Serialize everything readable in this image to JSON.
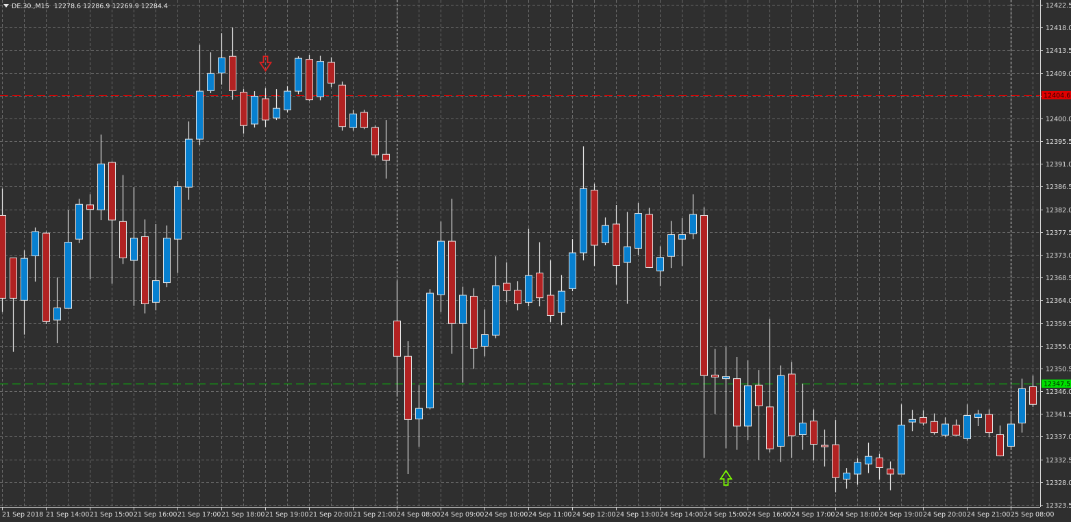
{
  "header": {
    "symbol": "DE.30.,M15",
    "open": "12278.6",
    "high": "12286.9",
    "low": "12269.9",
    "close": "12284.4"
  },
  "colors": {
    "background": "#2f2f2f",
    "grid": "#6a6a6a",
    "bull": "#0780d0",
    "bear": "#b22222",
    "candle_outline": "#e6e6e6",
    "axis_text": "#e0e0e0",
    "bid_line": "#e00000",
    "level_line": "#00dd00"
  },
  "chart_data": {
    "type": "candlestick",
    "title": "DE.30.,M15",
    "ylim": [
      12323.5,
      12422.5
    ],
    "grid": true,
    "y_ticks": [
      "12422.5",
      "12418.0",
      "12413.5",
      "12409.0",
      "12404.5",
      "12400.0",
      "12395.5",
      "12391.0",
      "12386.5",
      "12382.0",
      "12377.5",
      "12373.0",
      "12368.5",
      "12364.0",
      "12359.5",
      "12355.0",
      "12350.5",
      "12346.0",
      "12341.5",
      "12337.0",
      "12332.5",
      "12328.0",
      "12323.5"
    ],
    "x_ticks": [
      "21 Sep 2018",
      "21 Sep 14:00",
      "21 Sep 15:00",
      "21 Sep 16:00",
      "21 Sep 17:00",
      "21 Sep 18:00",
      "21 Sep 19:00",
      "21 Sep 20:00",
      "21 Sep 21:00",
      "24 Sep 08:00",
      "24 Sep 09:00",
      "24 Sep 10:00",
      "24 Sep 11:00",
      "24 Sep 12:00",
      "24 Sep 13:00",
      "24 Sep 14:00",
      "24 Sep 15:00",
      "24 Sep 16:00",
      "24 Sep 17:00",
      "24 Sep 18:00",
      "24 Sep 19:00",
      "24 Sep 20:00",
      "24 Sep 21:00",
      "25 Sep 08:00"
    ],
    "candle_fields": [
      "open",
      "high",
      "low",
      "close"
    ],
    "candles": [
      [
        12380.8,
        12386.1,
        12361.7,
        12364.4
      ],
      [
        12372.4,
        12372.4,
        12353.8,
        12364.4
      ],
      [
        12364.0,
        12373.9,
        12357.2,
        12372.3
      ],
      [
        12372.8,
        12378.4,
        12367.7,
        12377.6
      ],
      [
        12377.3,
        12377.6,
        12359.3,
        12359.8
      ],
      [
        12360.1,
        12368.5,
        12355.5,
        12362.5
      ],
      [
        12362.4,
        12381.9,
        12362.4,
        12375.5
      ],
      [
        12376.1,
        12384.1,
        12375.3,
        12383.0
      ],
      [
        12382.9,
        12385.0,
        12368.2,
        12382.0
      ],
      [
        12381.9,
        12396.8,
        12379.9,
        12391.0
      ],
      [
        12391.3,
        12391.5,
        12367.3,
        12379.9
      ],
      [
        12379.6,
        12388.8,
        12371.2,
        12372.4
      ],
      [
        12371.9,
        12386.4,
        12362.9,
        12376.3
      ],
      [
        12376.6,
        12380.0,
        12361.4,
        12363.3
      ],
      [
        12363.6,
        12379.1,
        12362.0,
        12367.9
      ],
      [
        12367.5,
        12378.8,
        12366.6,
        12376.3
      ],
      [
        12376.1,
        12387.6,
        12369.4,
        12386.5
      ],
      [
        12386.4,
        12399.4,
        12383.9,
        12395.9
      ],
      [
        12395.9,
        12414.6,
        12394.7,
        12405.4
      ],
      [
        12405.5,
        12413.1,
        12405.0,
        12408.9
      ],
      [
        12409.0,
        12416.9,
        12406.7,
        12412.0
      ],
      [
        12412.3,
        12418.0,
        12403.7,
        12405.5
      ],
      [
        12405.2,
        12405.8,
        12397.0,
        12398.6
      ],
      [
        12398.9,
        12405.4,
        12398.2,
        12404.4
      ],
      [
        12403.9,
        12406.0,
        12398.3,
        12399.7
      ],
      [
        12400.1,
        12405.8,
        12399.7,
        12402.0
      ],
      [
        12401.7,
        12406.4,
        12401.2,
        12405.4
      ],
      [
        12405.4,
        12412.3,
        12404.8,
        12411.9
      ],
      [
        12411.7,
        12412.6,
        12403.5,
        12403.7
      ],
      [
        12404.3,
        12412.4,
        12403.6,
        12411.3
      ],
      [
        12411.1,
        12412.1,
        12406.2,
        12407.0
      ],
      [
        12406.6,
        12407.3,
        12397.6,
        12398.4
      ],
      [
        12398.2,
        12401.7,
        12397.6,
        12400.9
      ],
      [
        12401.2,
        12401.7,
        12397.9,
        12398.2
      ],
      [
        12398.2,
        12398.6,
        12392.2,
        12392.8
      ],
      [
        12392.9,
        12399.7,
        12388.1,
        12391.7
      ],
      [
        12359.9,
        12367.8,
        12345.0,
        12352.9
      ],
      [
        12352.9,
        12355.9,
        12329.6,
        12340.4
      ],
      [
        12340.5,
        12347.2,
        12335.0,
        12342.6
      ],
      [
        12342.7,
        12366.2,
        12342.4,
        12365.4
      ],
      [
        12365.1,
        12379.6,
        12361.7,
        12375.7
      ],
      [
        12375.7,
        12384.1,
        12353.4,
        12359.4
      ],
      [
        12359.4,
        12366.7,
        12347.7,
        12365.0
      ],
      [
        12364.8,
        12366.4,
        12350.4,
        12354.5
      ],
      [
        12354.9,
        12362.2,
        12352.9,
        12357.2
      ],
      [
        12357.1,
        12372.7,
        12356.5,
        12366.9
      ],
      [
        12367.4,
        12371.5,
        12363.6,
        12365.9
      ],
      [
        12366.0,
        12367.8,
        12362.0,
        12363.3
      ],
      [
        12363.6,
        12378.2,
        12362.8,
        12368.9
      ],
      [
        12369.4,
        12375.5,
        12362.8,
        12364.5
      ],
      [
        12365.0,
        12371.9,
        12359.7,
        12361.0
      ],
      [
        12361.6,
        12369.0,
        12359.1,
        12365.8
      ],
      [
        12366.3,
        12376.1,
        12365.8,
        12373.4
      ],
      [
        12373.4,
        12394.5,
        12371.9,
        12386.1
      ],
      [
        12385.8,
        12387.1,
        12370.8,
        12374.9
      ],
      [
        12375.4,
        12380.4,
        12374.9,
        12378.8
      ],
      [
        12379.1,
        12382.9,
        12367.1,
        12370.9
      ],
      [
        12371.5,
        12381.5,
        12363.3,
        12374.6
      ],
      [
        12374.3,
        12383.3,
        12373.0,
        12381.2
      ],
      [
        12381.0,
        12382.3,
        12370.4,
        12370.5
      ],
      [
        12369.8,
        12374.7,
        12366.8,
        12372.5
      ],
      [
        12372.7,
        12379.7,
        12370.4,
        12377.0
      ],
      [
        12376.1,
        12380.3,
        12370.8,
        12377.0
      ],
      [
        12377.2,
        12385.0,
        12376.1,
        12381.0
      ],
      [
        12380.8,
        12382.4,
        12332.8,
        12349.1
      ],
      [
        12349.2,
        12354.4,
        12341.5,
        12348.8
      ],
      [
        12348.5,
        12354.8,
        12334.7,
        12348.9
      ],
      [
        12348.5,
        12352.8,
        12334.4,
        12339.1
      ],
      [
        12339.1,
        12352.1,
        12336.3,
        12347.1
      ],
      [
        12347.2,
        12350.2,
        12332.4,
        12343.1
      ],
      [
        12342.9,
        12360.3,
        12333.9,
        12334.6
      ],
      [
        12335.1,
        12351.1,
        12332.0,
        12349.1
      ],
      [
        12349.4,
        12351.8,
        12332.8,
        12337.2
      ],
      [
        12337.4,
        12347.5,
        12334.4,
        12339.7
      ],
      [
        12340.1,
        12342.4,
        12332.3,
        12335.5
      ],
      [
        12335.3,
        12338.4,
        12331.1,
        12335.0
      ],
      [
        12335.4,
        12340.3,
        12326.0,
        12328.9
      ],
      [
        12328.6,
        12330.8,
        12326.7,
        12329.8
      ],
      [
        12329.6,
        12332.7,
        12327.5,
        12331.9
      ],
      [
        12331.6,
        12335.8,
        12329.8,
        12333.1
      ],
      [
        12332.8,
        12333.6,
        12328.5,
        12330.9
      ],
      [
        12330.6,
        12332.1,
        12326.4,
        12329.6
      ],
      [
        12329.6,
        12343.4,
        12329.6,
        12339.3
      ],
      [
        12339.9,
        12342.3,
        12338.1,
        12340.4
      ],
      [
        12340.8,
        12342.2,
        12339.2,
        12339.7
      ],
      [
        12340.0,
        12341.6,
        12337.4,
        12337.8
      ],
      [
        12337.3,
        12340.8,
        12336.9,
        12339.5
      ],
      [
        12339.3,
        12340.4,
        12337.2,
        12337.3
      ],
      [
        12336.6,
        12343.4,
        12336.2,
        12341.2
      ],
      [
        12340.8,
        12342.3,
        12339.1,
        12341.5
      ],
      [
        12341.4,
        12342.4,
        12336.9,
        12337.8
      ],
      [
        12337.4,
        12339.2,
        12333.1,
        12333.2
      ],
      [
        12335.1,
        12341.9,
        12334.4,
        12339.5
      ],
      [
        12339.7,
        12348.5,
        12337.8,
        12346.5
      ],
      [
        12346.9,
        12349.1,
        12342.9,
        12343.4
      ]
    ],
    "session_breaks_at_candle": [
      36,
      92
    ],
    "horizontal_lines": [
      {
        "name": "bid-line",
        "price": 12404.6,
        "label": "12404.6",
        "color": "#e00000"
      },
      {
        "name": "level-line",
        "price": 12347.5,
        "label": "12347.5",
        "color": "#00dd00"
      }
    ],
    "arrows": [
      {
        "name": "sell-arrow",
        "direction": "down",
        "candle": 24,
        "price": 12410.8,
        "color": "#e02020"
      },
      {
        "name": "buy-arrow",
        "direction": "up",
        "candle": 66,
        "price": 12328.9,
        "color": "#7cfc00"
      }
    ]
  }
}
